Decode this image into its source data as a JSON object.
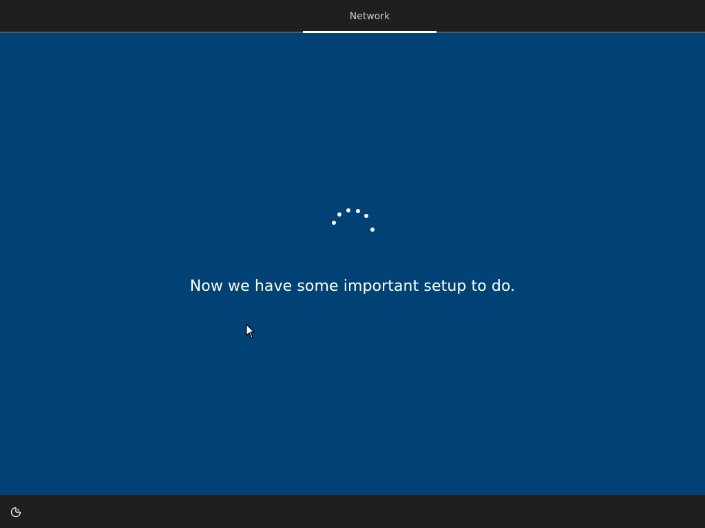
{
  "header": {
    "tabs": [
      {
        "label": "Network",
        "active": true
      }
    ]
  },
  "main": {
    "status_message": "Now we have some important setup to do.",
    "spinner": "loading-spinner"
  },
  "footer": {
    "ease_of_access_icon": "ease-of-access-icon"
  },
  "colors": {
    "background": "#004275",
    "bar_background": "#1f1f1f",
    "text": "#ffffff",
    "tab_text": "#c8c8c8"
  }
}
